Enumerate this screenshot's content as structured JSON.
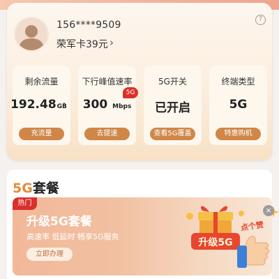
{
  "account": {
    "phone": "156****9509",
    "plan": "荣军卡39元",
    "chevron": "›",
    "help_icon": "?"
  },
  "tiles": [
    {
      "title": "剩余流量",
      "value": "192.48",
      "unit": "GB",
      "chevron": "›",
      "button": "充流量"
    },
    {
      "title": "下行峰值速率",
      "value": "300",
      "unit": "Mbps",
      "badge": "5G",
      "button": "去提速"
    },
    {
      "title": "5G开关",
      "value": "已开启",
      "button": "查看5G覆盖"
    },
    {
      "title": "终端类型",
      "value": "5G",
      "button": "特惠购机"
    }
  ],
  "section": {
    "title_accent": "5G",
    "title_rest": "套餐"
  },
  "banner": {
    "tag": "热门",
    "title": "升级5G套餐",
    "description": "高速率  低延时  畅享5G服务",
    "button": "立即办理",
    "art_text": "升级5G",
    "sticker_text": "点个赞",
    "close_icon": "×"
  },
  "colors": {
    "accent_orange": "#cf8647",
    "badge_red": "#d9302c",
    "title_accent": "#e58a3a"
  }
}
